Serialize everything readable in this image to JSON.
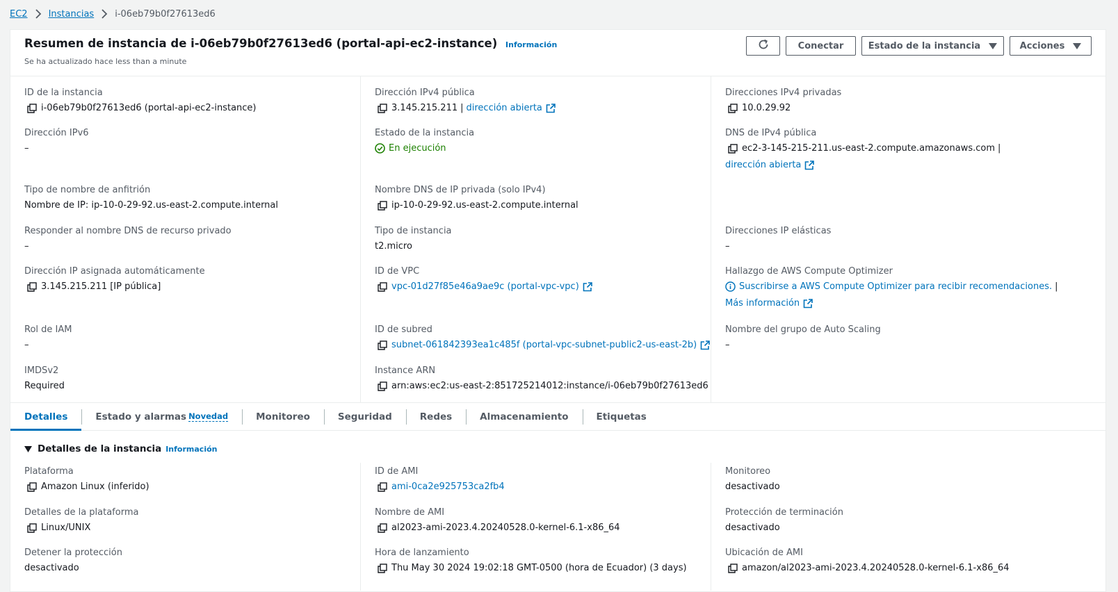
{
  "breadcrumb": {
    "ec2": "EC2",
    "instances": "Instancias",
    "current": "i-06eb79b0f27613ed6"
  },
  "header": {
    "title": "Resumen de instancia de i-06eb79b0f27613ed6 (portal-api-ec2-instance)",
    "info": "Información",
    "subtitle": "Se ha actualizado hace less than a minute",
    "connect_label": "Conectar",
    "state_label": "Estado de la instancia",
    "actions_label": "Acciones"
  },
  "summary": {
    "instance_id_label": "ID de la instancia",
    "instance_id_value": "i-06eb79b0f27613ed6 (portal-api-ec2-instance)",
    "ipv6_label": "Dirección IPv6",
    "ipv6_value": "–",
    "hostname_type_label": "Tipo de nombre de anfitrión",
    "hostname_type_value": "Nombre de IP: ip-10-0-29-92.us-east-2.compute.internal",
    "respond_dns_label": "Responder al nombre DNS de recurso privado",
    "respond_dns_value": "–",
    "auto_ip_label": "Dirección IP asignada automáticamente",
    "auto_ip_value": "3.145.215.211 [IP pública]",
    "iam_role_label": "Rol de IAM",
    "iam_role_value": "–",
    "imdsv2_label": "IMDSv2",
    "imdsv2_value": "Required",
    "public_ipv4_label": "Dirección IPv4 pública",
    "public_ipv4_value": "3.145.215.211",
    "open_address": "dirección abierta",
    "state_label": "Estado de la instancia",
    "state_value": "En ejecución",
    "private_dns_label": "Nombre DNS de IP privada (solo IPv4)",
    "private_dns_value": "ip-10-0-29-92.us-east-2.compute.internal",
    "instance_type_label": "Tipo de instancia",
    "instance_type_value": "t2.micro",
    "vpc_label": "ID de VPC",
    "vpc_value": "vpc-01d27f85e46a9ae9c (portal-vpc-vpc)",
    "subnet_label": "ID de subred",
    "subnet_value": "subnet-061842393ea1c485f (portal-vpc-subnet-public2-us-east-2b)",
    "arn_label": "Instance ARN",
    "arn_value": "arn:aws:ec2:us-east-2:851725214012:instance/i-06eb79b0f27613ed6",
    "private_ipv4_label": "Direcciones IPv4 privadas",
    "private_ipv4_value": "10.0.29.92",
    "public_dns_label": "DNS de IPv4 pública",
    "public_dns_value": "ec2-3-145-215-211.us-east-2.compute.amazonaws.com",
    "elastic_ip_label": "Direcciones IP elásticas",
    "elastic_ip_value": "–",
    "optimizer_label": "Hallazgo de AWS Compute Optimizer",
    "optimizer_link": "Suscribirse a AWS Compute Optimizer para recibir recomendaciones.",
    "more_info": "Más información",
    "asg_label": "Nombre del grupo de Auto Scaling",
    "asg_value": "–"
  },
  "tabs": {
    "details": "Detalles",
    "status": "Estado y alarmas",
    "new_badge": "Novedad",
    "monitoring": "Monitoreo",
    "security": "Seguridad",
    "networking": "Redes",
    "storage": "Almacenamiento",
    "tags": "Etiquetas"
  },
  "details": {
    "section_title": "Detalles de la instancia",
    "info": "Información",
    "platform_label": "Plataforma",
    "platform_value": "Amazon Linux (inferido)",
    "platform_details_label": "Detalles de la plataforma",
    "platform_details_value": "Linux/UNIX",
    "stop_protection_label": "Detener la protección",
    "stop_protection_value": "desactivado",
    "ami_id_label": "ID de AMI",
    "ami_id_value": "ami-0ca2e925753ca2fb4",
    "ami_name_label": "Nombre de AMI",
    "ami_name_value": "al2023-ami-2023.4.20240528.0-kernel-6.1-x86_64",
    "launch_time_label": "Hora de lanzamiento",
    "launch_time_value": "Thu May 30 2024 19:02:18 GMT-0500 (hora de Ecuador) (3 days)",
    "monitoring_label": "Monitoreo",
    "monitoring_value": "desactivado",
    "termination_label": "Protección de terminación",
    "termination_value": "desactivado",
    "ami_location_label": "Ubicación de AMI",
    "ami_location_value": "amazon/al2023-ami-2023.4.20240528.0-kernel-6.1-x86_64"
  },
  "colors": {
    "link": "#0073bb",
    "success": "#1d8102",
    "border": "#eaeded",
    "text": "#16191f",
    "muted": "#545b64"
  },
  "icons": [
    "chevron-right-icon",
    "refresh-icon",
    "caret-down-icon",
    "copy-icon",
    "external-link-icon",
    "check-circle-icon",
    "info-circle-icon",
    "triangle-down-icon"
  ]
}
